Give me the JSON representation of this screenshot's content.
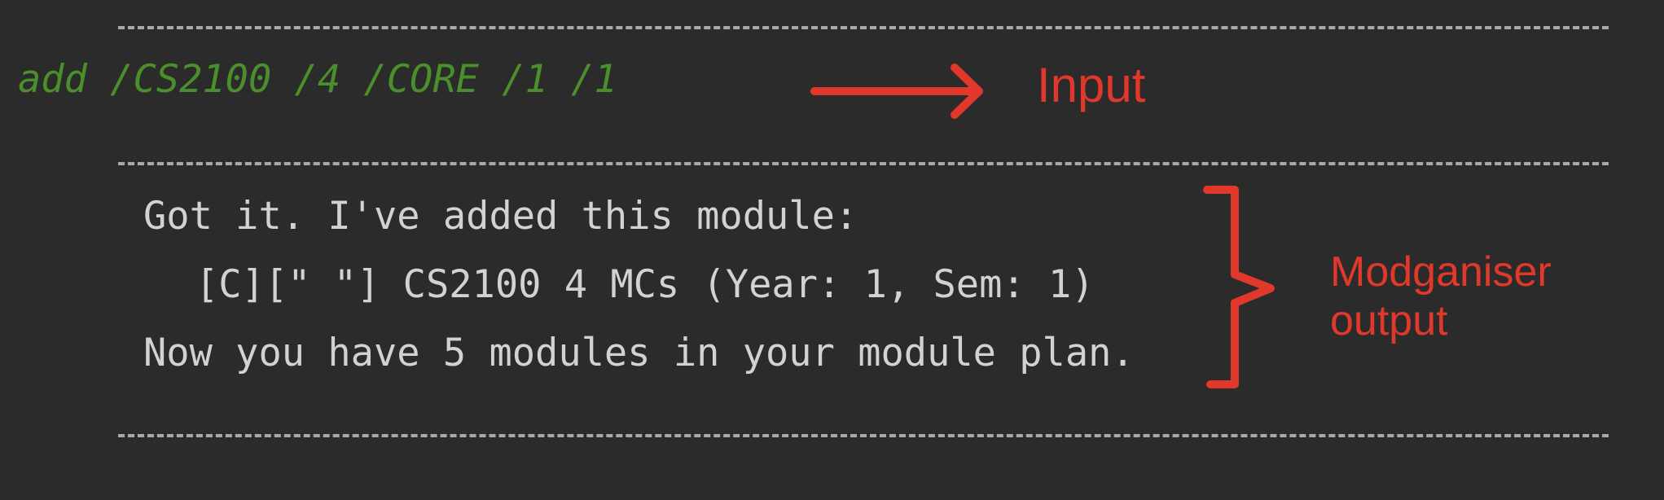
{
  "terminal": {
    "command": "add /CS2100 /4 /CORE /1 /1",
    "output_lines": [
      "Got it. I've added this module:",
      "[C][\" \"] CS2100 4 MCs (Year: 1, Sem: 1)",
      "Now you have 5 modules in your module plan."
    ]
  },
  "annotations": {
    "input_label": "Input",
    "output_label": "Modganiser output",
    "color": "#e0382b"
  },
  "colors": {
    "background": "#2b2b2b",
    "command_text": "#4b8f2c",
    "output_text": "#d2d2d2",
    "divider": "#a9a9a9"
  }
}
